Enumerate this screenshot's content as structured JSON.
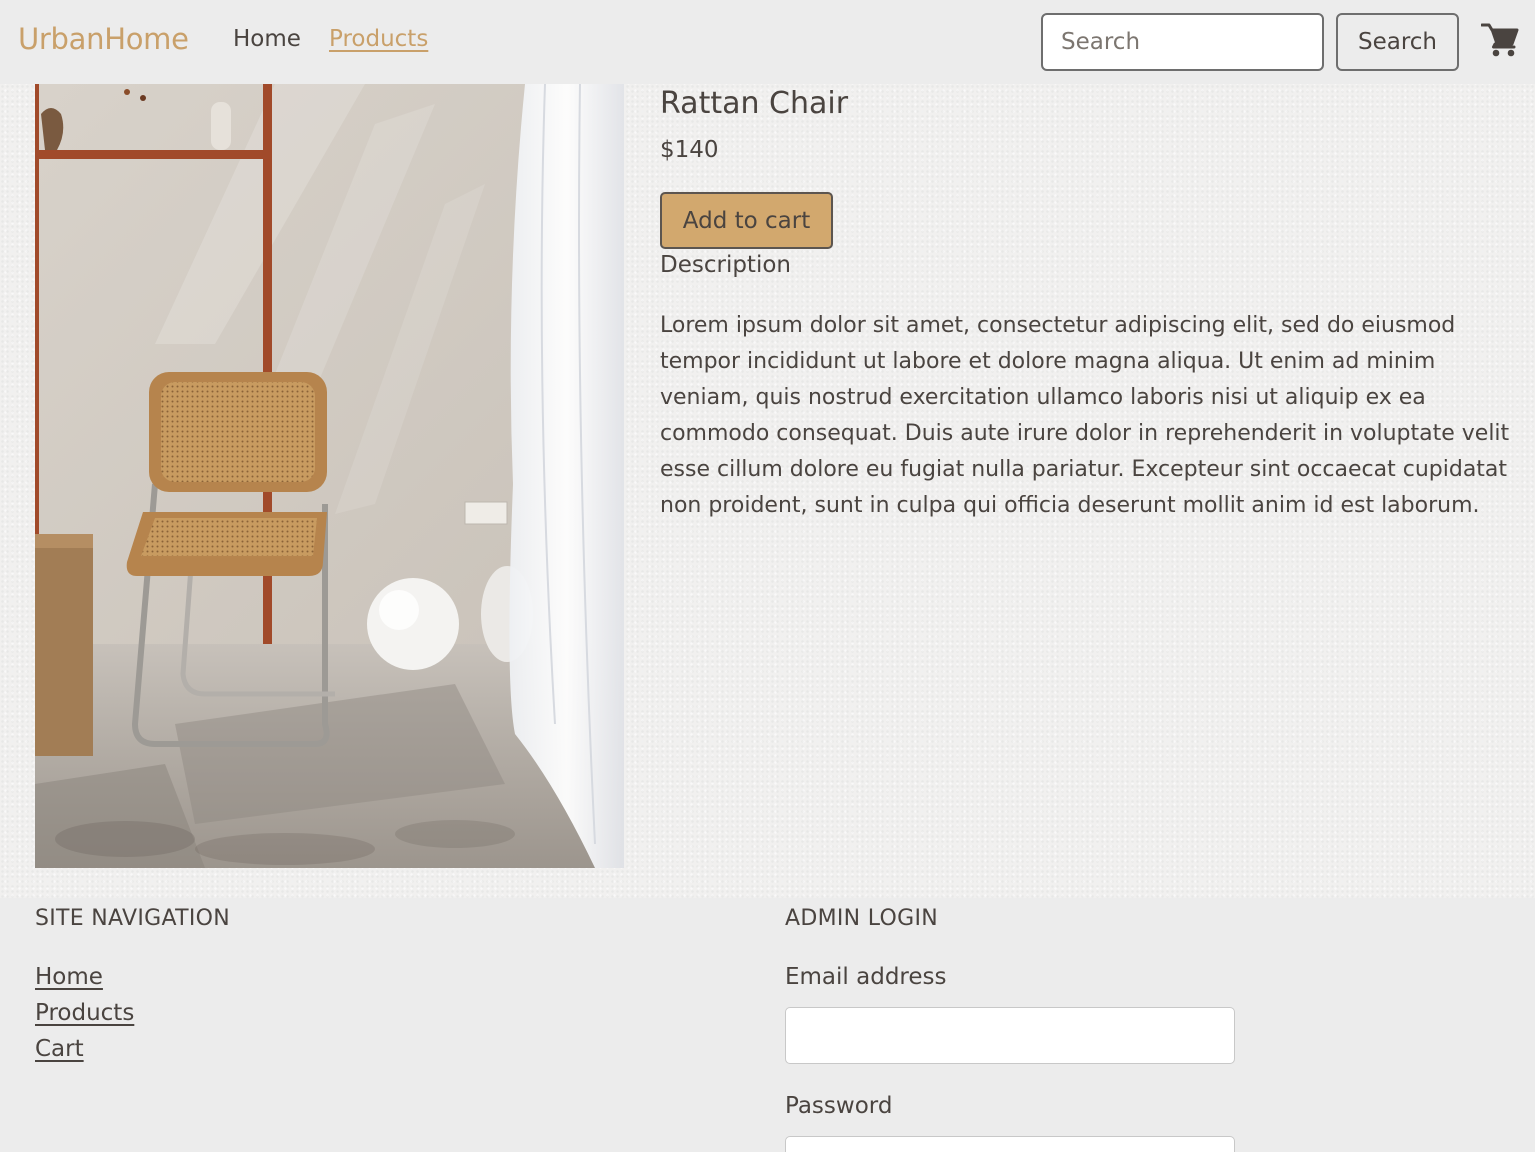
{
  "header": {
    "brand": "UrbanHome",
    "nav": [
      {
        "label": "Home"
      },
      {
        "label": "Products"
      }
    ],
    "search": {
      "placeholder": "Search",
      "value": "",
      "button_label": "Search"
    },
    "cart_icon": "shopping-cart-icon"
  },
  "product": {
    "title": "Rattan Chair",
    "price": "$140",
    "add_to_cart_label": "Add to cart",
    "description_heading": "Description",
    "description": "Lorem ipsum dolor sit amet, consectetur adipiscing elit, sed do eiusmod tempor incididunt ut labore et dolore magna aliqua. Ut enim ad minim veniam, quis nostrud exercitation ullamco laboris nisi ut aliquip ex ea commodo consequat. Duis aute irure dolor in reprehenderit in voluptate velit esse cillum dolore eu fugiat nulla pariatur. Excepteur sint occaecat cupidatat non proident, sunt in culpa qui officia deserunt mollit anim id est laborum."
  },
  "footer": {
    "site_navigation": {
      "heading": "SITE NAVIGATION",
      "links": [
        {
          "label": "Home"
        },
        {
          "label": "Products"
        },
        {
          "label": "Cart"
        }
      ]
    },
    "admin_login": {
      "heading": "ADMIN LOGIN",
      "email_label": "Email address",
      "email_value": "",
      "password_label": "Password",
      "password_value": ""
    }
  },
  "colors": {
    "accent": "#c9a06a",
    "button_fill": "#d2a86e",
    "text": "#4a4440",
    "background": "#ececec"
  }
}
